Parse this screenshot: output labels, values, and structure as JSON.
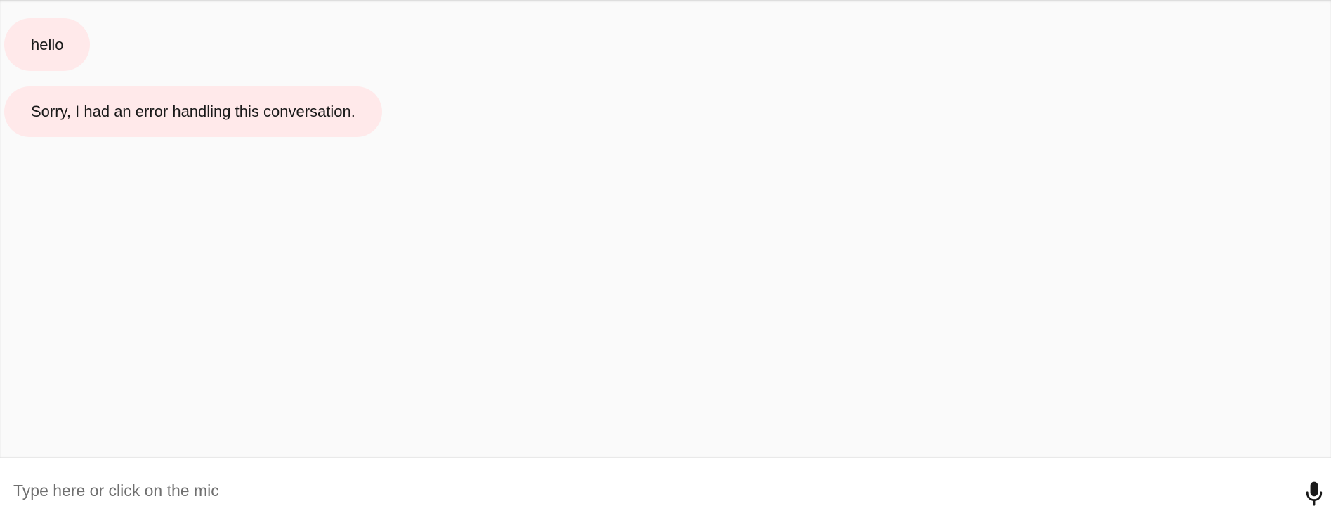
{
  "messages": [
    {
      "text": "hello"
    },
    {
      "text": "Sorry, I had an error handling this conversation."
    }
  ],
  "composer": {
    "placeholder": "Type here or click on the mic",
    "value": "",
    "mic_icon": "microphone-icon"
  },
  "colors": {
    "background": "#fafafa",
    "bubble": "#ffe9ea",
    "composer_bg": "#ffffff",
    "text": "#1a1a1a",
    "placeholder": "#6f6f6f"
  }
}
